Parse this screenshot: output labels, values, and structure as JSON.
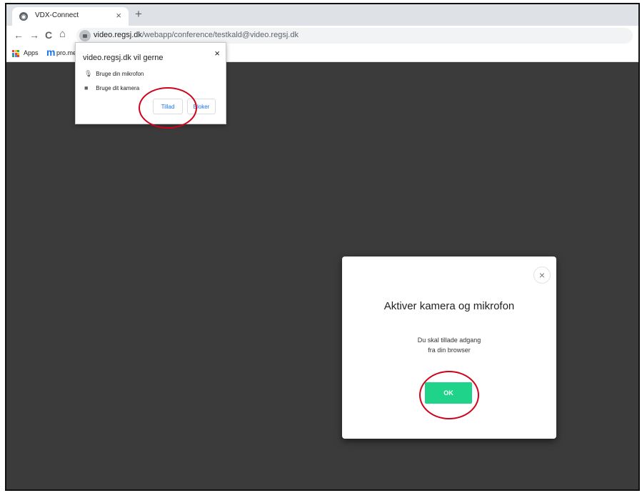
{
  "tab": {
    "title": "VDX-Connect",
    "close": "×",
    "new_tab": "+"
  },
  "nav": {
    "back": "←",
    "forward": "→",
    "reload": "C",
    "home": "⌂"
  },
  "address": {
    "host": "video.regsj.dk",
    "rest": "/webapp/conference/testkald@video.regsj.dk"
  },
  "bookmarks": {
    "apps": "Apps",
    "m_logo": "m",
    "pro_label": "pro.mec"
  },
  "permission": {
    "title": "video.regsj.dk vil gerne",
    "close": "×",
    "mic": "Bruge din mikrofon",
    "camera": "Bruge dit kamera",
    "allow": "Tillad",
    "block": "Bloker"
  },
  "modal": {
    "close": "×",
    "title": "Aktiver kamera og mikrofon",
    "line1": "Du skal tillade adgang",
    "line2": "fra din browser",
    "ok": "OK"
  },
  "colors": {
    "accent": "#1fd38a",
    "annotation": "#d0021b",
    "page_bg": "#3b3b3b"
  }
}
